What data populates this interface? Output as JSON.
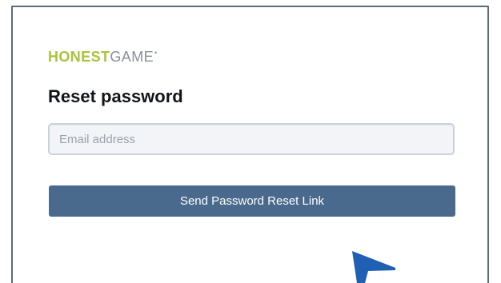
{
  "brand": {
    "name_strong": "HONEST",
    "name_light": "GAME",
    "mark": "•",
    "colors": {
      "strong": "#a9c43a",
      "light": "#8a8f96"
    }
  },
  "form": {
    "title": "Reset password",
    "email": {
      "value": "",
      "placeholder": "Email address"
    },
    "submit_label": "Send Password Reset Link"
  },
  "colors": {
    "button": "#4a6a8d",
    "cursor": "#1f5fb4",
    "frame_border": "#5d6a78"
  },
  "icons": {
    "cursor": "mouse-pointer-icon"
  }
}
